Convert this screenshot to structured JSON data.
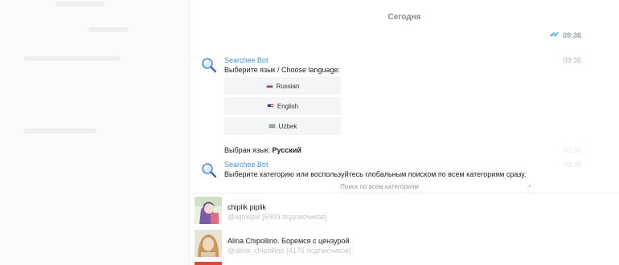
{
  "chat": {
    "date_separator": "Сегодня",
    "outgoing_time": "09:36",
    "messages": [
      {
        "sender": "Searchee Bot",
        "time": "09:36",
        "text": "Выберите язык / Choose language:",
        "buttons": [
          {
            "label": "Russian",
            "flag": "ru-flag-icon"
          },
          {
            "label": "English",
            "flag": "us-flag-icon"
          },
          {
            "label": "Uzbek",
            "flag": "uz-flag-icon"
          }
        ]
      },
      {
        "prefix": "Выбран язык:",
        "value": "Русский",
        "time": "09:36"
      },
      {
        "sender": "Searchee Bot",
        "time": "09:36",
        "text": "Выберите категорию или воспользуйтесь глобальным поиском по всем категориям сразу.",
        "button_label": "Поиск по всем категориям"
      }
    ]
  },
  "results": [
    {
      "title": "chiplik piplik",
      "subtitle": "@wjoxqwi [6909 подписчиков]"
    },
    {
      "title": "Alina Chipollino. Боремся с цензурой",
      "subtitle": "@alina_chipollino [4175 подписчиков]"
    }
  ],
  "colors": {
    "sender": "#4a90c9",
    "checks": "#55a9e0",
    "time": "#b4b9bf"
  }
}
